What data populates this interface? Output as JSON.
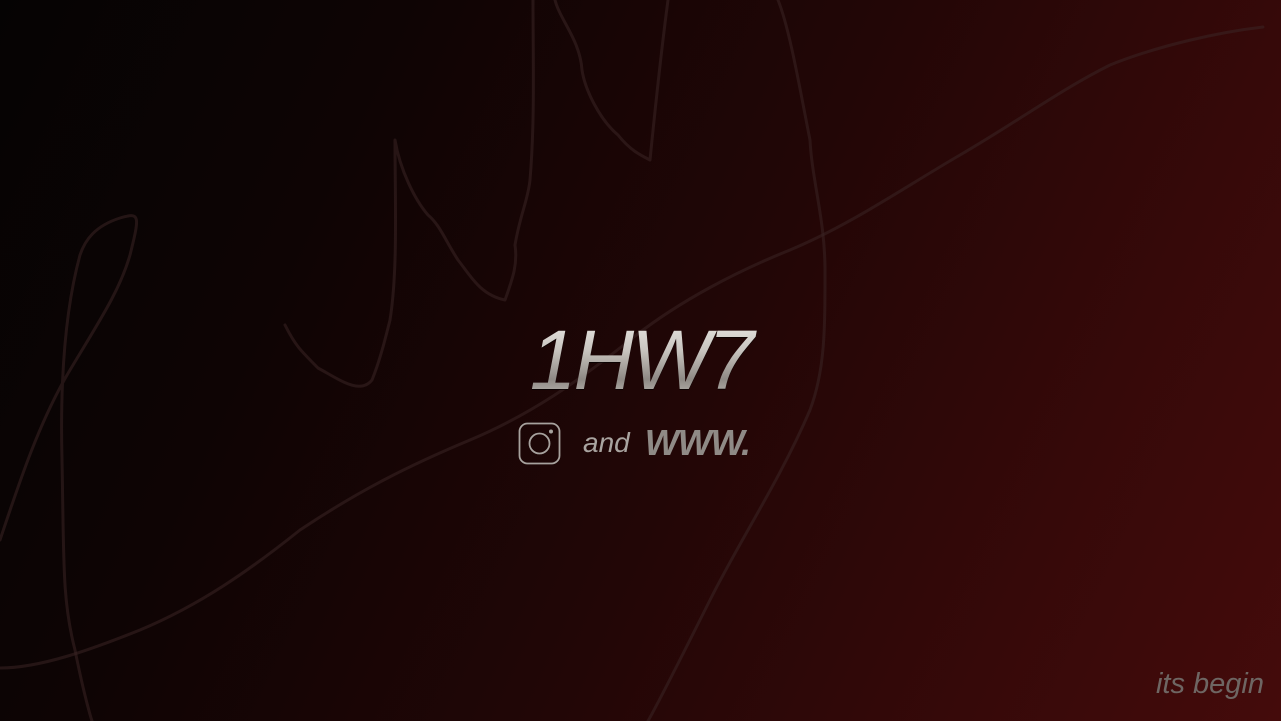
{
  "hero": {
    "logo_text": "1HW7",
    "connector_text": "and",
    "website_link_text": "WWW."
  },
  "icons": {
    "social": "instagram-icon"
  },
  "footer": {
    "tagline": "its begin"
  },
  "colors": {
    "background_dark": "#050303",
    "background_red": "#440b0b",
    "logo_silver": "#c8c4bf",
    "scribble_stroke": "#3a2424",
    "muted_text": "#6e6663"
  }
}
